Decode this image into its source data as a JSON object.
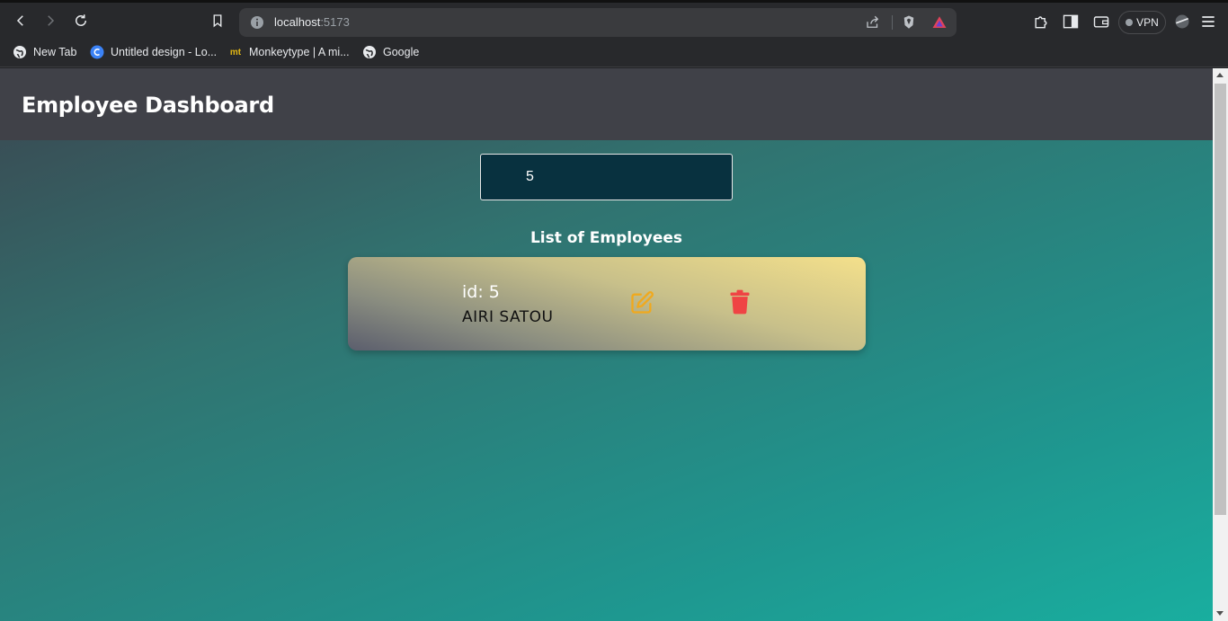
{
  "browser": {
    "url_host": "localhost",
    "url_port": ":5173",
    "vpn_label": "VPN",
    "bookmarks": [
      {
        "label": "New Tab",
        "icon": "globe-icon"
      },
      {
        "label": "Untitled design - Lo...",
        "icon": "canva-icon"
      },
      {
        "label": "Monkeytype | A mi...",
        "icon": "monkeytype-icon"
      },
      {
        "label": "Google",
        "icon": "globe-icon"
      }
    ],
    "monkeytype_icon_text": "mt"
  },
  "page": {
    "title": "Employee Dashboard",
    "search_value": "5",
    "list_title": "List of Employees",
    "employees": [
      {
        "id_label": "id: 5",
        "name": "AIRI SATOU"
      }
    ]
  },
  "colors": {
    "header_bg": "#404148",
    "search_bg": "#08313f",
    "edit_icon": "#f0a91e",
    "delete_icon": "#ef4444"
  }
}
